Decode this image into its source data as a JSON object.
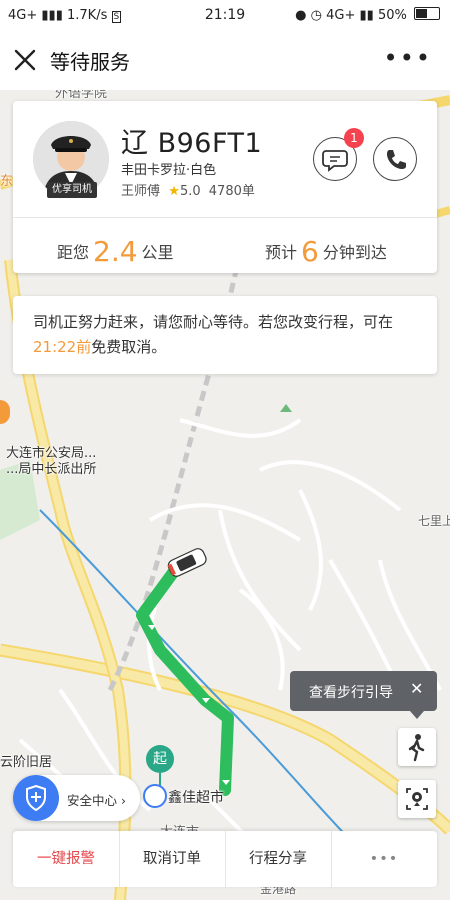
{
  "status_bar": {
    "network_left": "4G+",
    "speed": "1.7K/s",
    "time": "21:19",
    "network_right": "4G+",
    "battery": "50%",
    "battery_level": 0.5
  },
  "nav": {
    "title": "等待服务"
  },
  "driver": {
    "plate": "辽 B96FT1",
    "car": "丰田卡罗拉·白色",
    "name": "王师傅",
    "rating": "5.0",
    "orders": "4780单",
    "badge": "优享司机",
    "unread_count": "1"
  },
  "trip": {
    "dist_prefix": "距您",
    "dist_value": "2.4",
    "dist_unit": "公里",
    "eta_prefix": "预计",
    "eta_value": "6",
    "eta_unit": "分钟到达"
  },
  "notice": {
    "text_part1": "司机正努力赶来，请您耐心等待。若您改变行程，可在",
    "deadline": "21:22前",
    "text_part2": "免费取消。"
  },
  "map": {
    "labels": {
      "police_1": "大连市公安局...",
      "police_2": "...局中长派出所",
      "qili": "七里上",
      "yunjie": "云阶旧居",
      "market": "鑫佳超市",
      "dalian": "大连市",
      "start": "起",
      "street": "外语学院",
      "east": "东",
      "gangwan": "金港路"
    },
    "route_color": "#2ebd5c"
  },
  "walk_tip": {
    "label": "查看步行引导",
    "close": "✕"
  },
  "safety": {
    "label": "安全中心"
  },
  "bottom": {
    "alarm": "一键报警",
    "cancel": "取消订单",
    "share": "行程分享",
    "more": "•••"
  },
  "colors": {
    "accent": "#f39a3b",
    "alarm": "#e5484d",
    "brand_blue": "#3d7cf2"
  },
  "icons": [
    "close-icon",
    "more-icon",
    "chat-icon",
    "phone-icon",
    "star-icon",
    "walk-icon",
    "locate-icon",
    "shield-icon",
    "car-icon"
  ]
}
